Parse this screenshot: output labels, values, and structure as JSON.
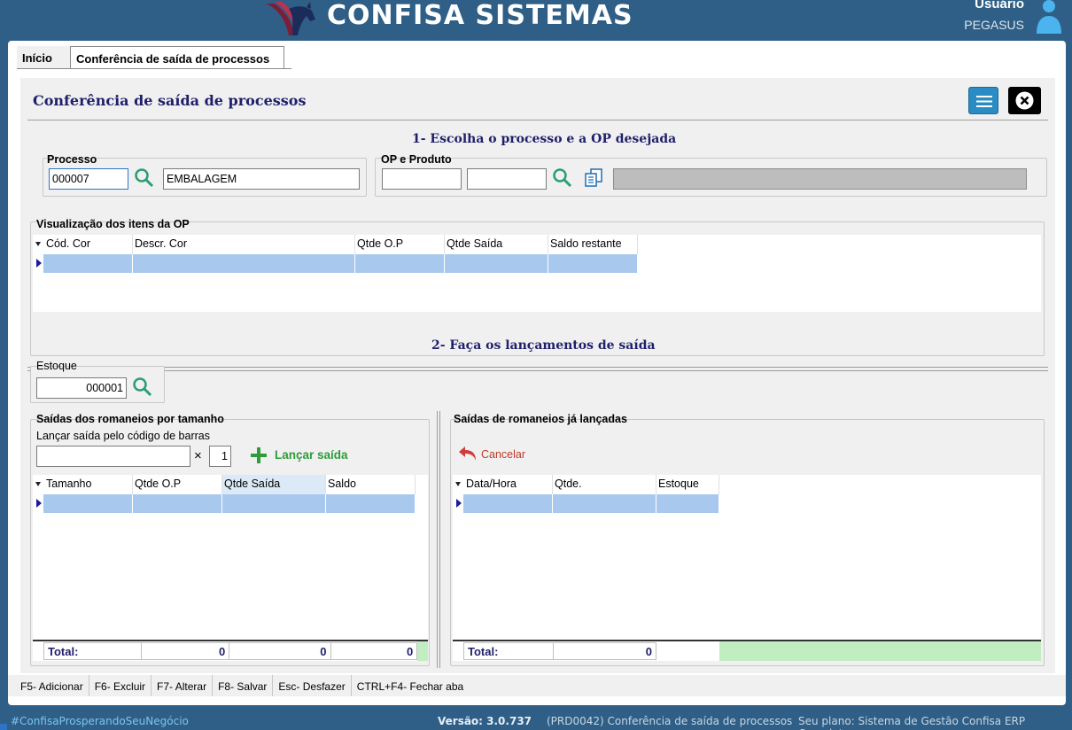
{
  "header": {
    "brand": "CONFISA SISTEMAS",
    "user_label": "Usuário",
    "user_name": "PEGASUS"
  },
  "tabs": [
    {
      "label": "Início"
    },
    {
      "label": "Conferência de saída de processos"
    }
  ],
  "panel": {
    "title": "Conferência de saída de processos"
  },
  "step1": {
    "title": "1- Escolha o processo e a OP desejada",
    "processo": {
      "label": "Processo",
      "code": "000007",
      "name": "EMBALAGEM"
    },
    "op": {
      "label": "OP e Produto",
      "op_value": "",
      "produto_value": "",
      "description": ""
    },
    "items": {
      "label": "Visualização dos itens da OP",
      "columns": [
        "Cód. Cor",
        "Descr. Cor",
        "Qtde O.P",
        "Qtde Saída",
        "Saldo restante"
      ]
    }
  },
  "step2": {
    "title": "2- Faça os lançamentos de saída",
    "estoque": {
      "label": "Estoque",
      "value": "000001"
    },
    "romaneios": {
      "label": "Saídas dos romaneios por tamanho",
      "barcode_label": "Lançar saída pelo código de barras",
      "barcode_value": "",
      "times": "×",
      "qty": "1",
      "add_label": "Lançar saída",
      "columns": [
        "Tamanho",
        "Qtde O.P",
        "Qtde Saída",
        "Saldo"
      ],
      "total_label": "Total:",
      "totals": [
        "0",
        "0",
        "0"
      ]
    },
    "lancadas": {
      "label": "Saídas de romaneios já lançadas",
      "cancel_label": "Cancelar",
      "columns": [
        "Data/Hora",
        "Qtde.",
        "Estoque"
      ],
      "total_label": "Total:",
      "totals": [
        "0"
      ]
    }
  },
  "shortcuts": [
    "F5- Adicionar",
    "F6- Excluir",
    "F7- Alterar",
    "F8- Salvar",
    "Esc- Desfazer",
    "CTRL+F4- Fechar aba"
  ],
  "status": {
    "hashtag": "#ConfisaProsperandoSeuNegócio",
    "version": "Versão: 3.0.737",
    "screen": "(PRD0042) Conferência de saída de processos",
    "plan": "Seu plano: Sistema de Gestão Confisa ERP Completo"
  },
  "colors": {
    "background": "#2f5f86",
    "title_blue": "#1f1f6b",
    "row_selected": "#a8c8ee",
    "add_green": "#2e9c3a",
    "cancel_red": "#c0392b",
    "total_green": "#c0eec0"
  }
}
